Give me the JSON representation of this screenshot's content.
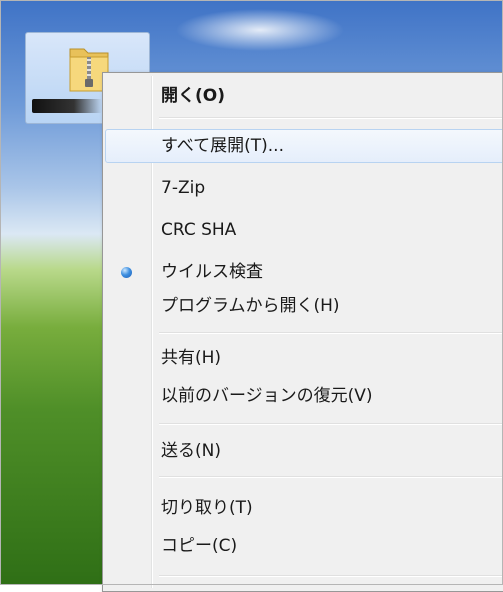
{
  "menu": {
    "items": [
      {
        "label": "開く(O)"
      },
      {
        "label": "すべて展開(T)..."
      },
      {
        "label": "7-Zip"
      },
      {
        "label": "CRC SHA"
      },
      {
        "label": "ウイルス検査"
      },
      {
        "label": "プログラムから開く(H)"
      },
      {
        "label": "共有(H)"
      },
      {
        "label": "以前のバージョンの復元(V)"
      },
      {
        "label": "送る(N)"
      },
      {
        "label": "切り取り(T)"
      },
      {
        "label": "コピー(C)"
      }
    ]
  },
  "colors": {
    "menu_bg": "#f0f0f0",
    "hover_border": "#b8d3f1",
    "bullet": "#3d8fe0"
  }
}
